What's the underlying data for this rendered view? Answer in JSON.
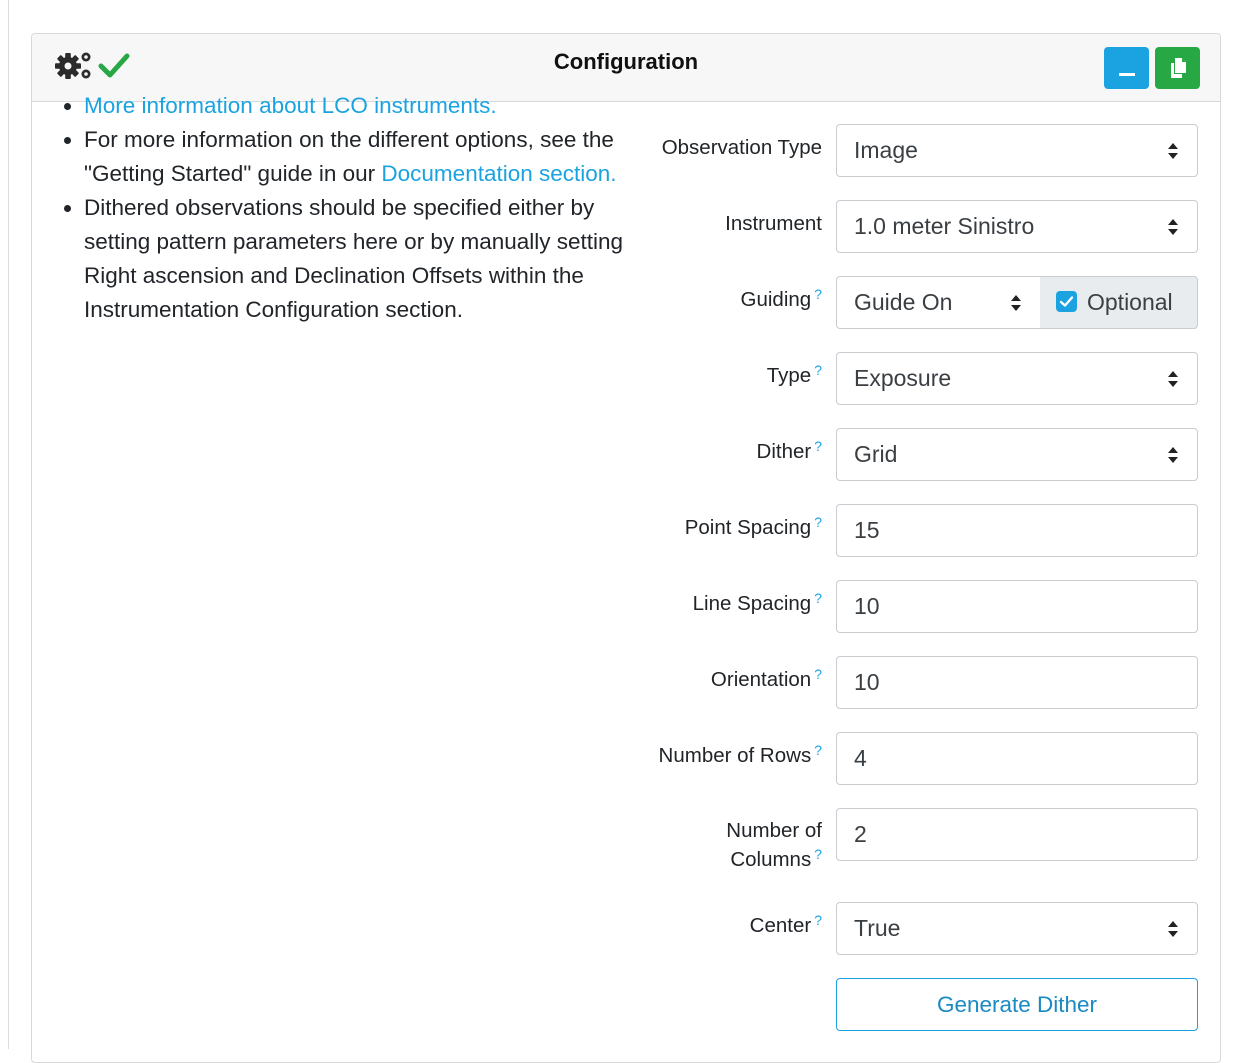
{
  "card": {
    "title": "Configuration"
  },
  "info": {
    "item1_link": "More information about LCO instruments.",
    "item2_text": "For more information on the different options, see the \"Getting Started\" guide in our ",
    "item2_link": "Documentation section.",
    "item3_text": "Dithered observations should be specified either by setting pattern parameters here or by manually setting Right ascension and Declination Offsets within the Instrumentation Configuration section."
  },
  "form": {
    "observation_type": {
      "label": "Observation Type",
      "value": "Image"
    },
    "instrument": {
      "label": "Instrument",
      "value": "1.0 meter Sinistro"
    },
    "guiding": {
      "label": "Guiding",
      "value": "Guide On",
      "optional_label": "Optional",
      "optional_checked": true
    },
    "type": {
      "label": "Type",
      "value": "Exposure"
    },
    "dither": {
      "label": "Dither",
      "value": "Grid"
    },
    "point_spacing": {
      "label": "Point Spacing",
      "value": "15"
    },
    "line_spacing": {
      "label": "Line Spacing",
      "value": "10"
    },
    "orientation": {
      "label": "Orientation",
      "value": "10"
    },
    "number_of_rows": {
      "label": "Number of Rows",
      "value": "4"
    },
    "number_of_columns": {
      "label_line1": "Number of",
      "label_line2": "Columns",
      "value": "2"
    },
    "center": {
      "label": "Center",
      "value": "True"
    },
    "help_mark": "?",
    "generate_label": "Generate Dither"
  },
  "colors": {
    "accent": "#1aa3e0",
    "success": "#28a745",
    "header_bg": "#f7f7f7"
  }
}
